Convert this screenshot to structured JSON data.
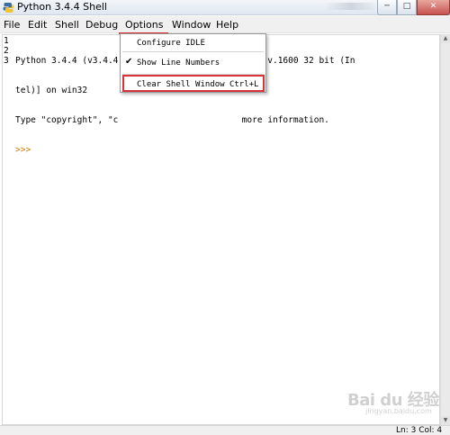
{
  "window": {
    "title": "Python 3.4.4 Shell",
    "buttons": {
      "minimize": "─",
      "maximize": "□",
      "close": "✕"
    }
  },
  "menubar": {
    "items": [
      "File",
      "Edit",
      "Shell",
      "Debug",
      "Options",
      "Window",
      "Help"
    ]
  },
  "shell": {
    "line_numbers": [
      "1",
      "2",
      "3"
    ],
    "lines": [
      "Python 3.4.4 (v3.4.4              19:28:18) [MSC v.1600 32 bit (In",
      "tel)] on win32",
      "Type \"copyright\", \"c                        more information."
    ],
    "prompt": ">>>"
  },
  "options_menu": {
    "items": [
      {
        "label": "Configure IDLE",
        "checked": false
      },
      {
        "label": "Show Line Numbers",
        "checked": true
      },
      {
        "label": "Clear Shell Window Ctrl+L",
        "checked": false
      }
    ],
    "check_glyph": "✔"
  },
  "statusbar": {
    "text": "Ln: 3   Col: 4"
  },
  "watermark": {
    "text": "Bai du 经验",
    "sub": "jingyan.baidu.com"
  },
  "colors": {
    "highlight_border": "#d9343a",
    "menu_hover": "#d7e6f7",
    "prompt": "#c77700"
  }
}
